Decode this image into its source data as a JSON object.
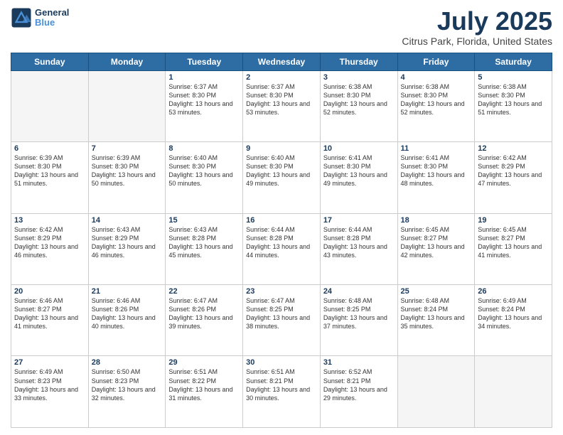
{
  "header": {
    "logo_line1": "General",
    "logo_line2": "Blue",
    "title": "July 2025",
    "subtitle": "Citrus Park, Florida, United States"
  },
  "days_of_week": [
    "Sunday",
    "Monday",
    "Tuesday",
    "Wednesday",
    "Thursday",
    "Friday",
    "Saturday"
  ],
  "weeks": [
    [
      {
        "day": "",
        "info": ""
      },
      {
        "day": "",
        "info": ""
      },
      {
        "day": "1",
        "info": "Sunrise: 6:37 AM\nSunset: 8:30 PM\nDaylight: 13 hours and 53 minutes."
      },
      {
        "day": "2",
        "info": "Sunrise: 6:37 AM\nSunset: 8:30 PM\nDaylight: 13 hours and 53 minutes."
      },
      {
        "day": "3",
        "info": "Sunrise: 6:38 AM\nSunset: 8:30 PM\nDaylight: 13 hours and 52 minutes."
      },
      {
        "day": "4",
        "info": "Sunrise: 6:38 AM\nSunset: 8:30 PM\nDaylight: 13 hours and 52 minutes."
      },
      {
        "day": "5",
        "info": "Sunrise: 6:38 AM\nSunset: 8:30 PM\nDaylight: 13 hours and 51 minutes."
      }
    ],
    [
      {
        "day": "6",
        "info": "Sunrise: 6:39 AM\nSunset: 8:30 PM\nDaylight: 13 hours and 51 minutes."
      },
      {
        "day": "7",
        "info": "Sunrise: 6:39 AM\nSunset: 8:30 PM\nDaylight: 13 hours and 50 minutes."
      },
      {
        "day": "8",
        "info": "Sunrise: 6:40 AM\nSunset: 8:30 PM\nDaylight: 13 hours and 50 minutes."
      },
      {
        "day": "9",
        "info": "Sunrise: 6:40 AM\nSunset: 8:30 PM\nDaylight: 13 hours and 49 minutes."
      },
      {
        "day": "10",
        "info": "Sunrise: 6:41 AM\nSunset: 8:30 PM\nDaylight: 13 hours and 49 minutes."
      },
      {
        "day": "11",
        "info": "Sunrise: 6:41 AM\nSunset: 8:30 PM\nDaylight: 13 hours and 48 minutes."
      },
      {
        "day": "12",
        "info": "Sunrise: 6:42 AM\nSunset: 8:29 PM\nDaylight: 13 hours and 47 minutes."
      }
    ],
    [
      {
        "day": "13",
        "info": "Sunrise: 6:42 AM\nSunset: 8:29 PM\nDaylight: 13 hours and 46 minutes."
      },
      {
        "day": "14",
        "info": "Sunrise: 6:43 AM\nSunset: 8:29 PM\nDaylight: 13 hours and 46 minutes."
      },
      {
        "day": "15",
        "info": "Sunrise: 6:43 AM\nSunset: 8:28 PM\nDaylight: 13 hours and 45 minutes."
      },
      {
        "day": "16",
        "info": "Sunrise: 6:44 AM\nSunset: 8:28 PM\nDaylight: 13 hours and 44 minutes."
      },
      {
        "day": "17",
        "info": "Sunrise: 6:44 AM\nSunset: 8:28 PM\nDaylight: 13 hours and 43 minutes."
      },
      {
        "day": "18",
        "info": "Sunrise: 6:45 AM\nSunset: 8:27 PM\nDaylight: 13 hours and 42 minutes."
      },
      {
        "day": "19",
        "info": "Sunrise: 6:45 AM\nSunset: 8:27 PM\nDaylight: 13 hours and 41 minutes."
      }
    ],
    [
      {
        "day": "20",
        "info": "Sunrise: 6:46 AM\nSunset: 8:27 PM\nDaylight: 13 hours and 41 minutes."
      },
      {
        "day": "21",
        "info": "Sunrise: 6:46 AM\nSunset: 8:26 PM\nDaylight: 13 hours and 40 minutes."
      },
      {
        "day": "22",
        "info": "Sunrise: 6:47 AM\nSunset: 8:26 PM\nDaylight: 13 hours and 39 minutes."
      },
      {
        "day": "23",
        "info": "Sunrise: 6:47 AM\nSunset: 8:25 PM\nDaylight: 13 hours and 38 minutes."
      },
      {
        "day": "24",
        "info": "Sunrise: 6:48 AM\nSunset: 8:25 PM\nDaylight: 13 hours and 37 minutes."
      },
      {
        "day": "25",
        "info": "Sunrise: 6:48 AM\nSunset: 8:24 PM\nDaylight: 13 hours and 35 minutes."
      },
      {
        "day": "26",
        "info": "Sunrise: 6:49 AM\nSunset: 8:24 PM\nDaylight: 13 hours and 34 minutes."
      }
    ],
    [
      {
        "day": "27",
        "info": "Sunrise: 6:49 AM\nSunset: 8:23 PM\nDaylight: 13 hours and 33 minutes."
      },
      {
        "day": "28",
        "info": "Sunrise: 6:50 AM\nSunset: 8:23 PM\nDaylight: 13 hours and 32 minutes."
      },
      {
        "day": "29",
        "info": "Sunrise: 6:51 AM\nSunset: 8:22 PM\nDaylight: 13 hours and 31 minutes."
      },
      {
        "day": "30",
        "info": "Sunrise: 6:51 AM\nSunset: 8:21 PM\nDaylight: 13 hours and 30 minutes."
      },
      {
        "day": "31",
        "info": "Sunrise: 6:52 AM\nSunset: 8:21 PM\nDaylight: 13 hours and 29 minutes."
      },
      {
        "day": "",
        "info": ""
      },
      {
        "day": "",
        "info": ""
      }
    ]
  ]
}
